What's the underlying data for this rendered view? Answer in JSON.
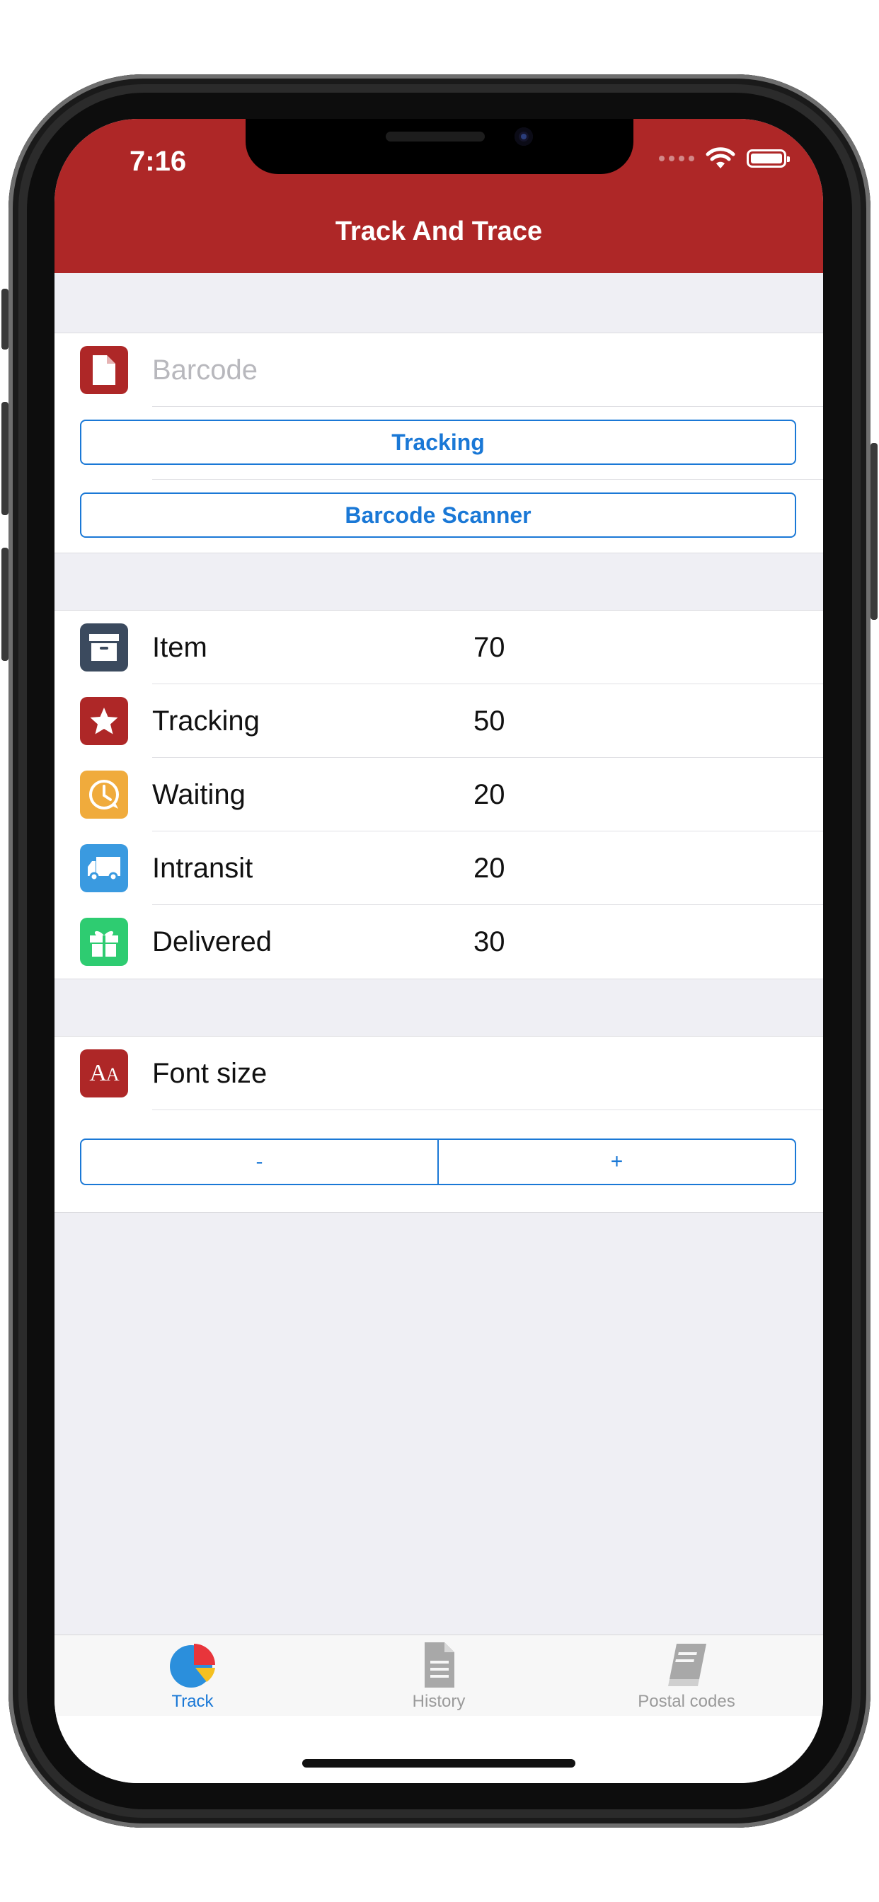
{
  "status_bar": {
    "time": "7:16"
  },
  "nav": {
    "title": "Track And Trace"
  },
  "search": {
    "placeholder": "Barcode",
    "tracking_button": "Tracking",
    "scanner_button": "Barcode Scanner"
  },
  "stats": [
    {
      "label": "Item",
      "value": "70",
      "icon": "archive-box-icon",
      "color": "#3b4a5e"
    },
    {
      "label": "Tracking",
      "value": "50",
      "icon": "star-icon",
      "color": "#ae2727"
    },
    {
      "label": "Waiting",
      "value": "20",
      "icon": "clock-icon",
      "color": "#f0ab3c"
    },
    {
      "label": "Intransit",
      "value": "20",
      "icon": "truck-icon",
      "color": "#3a9ae0"
    },
    {
      "label": "Delivered",
      "value": "30",
      "icon": "gift-icon",
      "color": "#2ecc71"
    }
  ],
  "font_size": {
    "label": "Font size",
    "icon": "font-size-icon",
    "decrease": "-",
    "increase": "+"
  },
  "tabbar": {
    "tabs": [
      {
        "label": "Track",
        "icon": "pie-chart-icon",
        "active": true
      },
      {
        "label": "History",
        "icon": "document-icon",
        "active": false
      },
      {
        "label": "Postal codes",
        "icon": "book-icon",
        "active": false
      }
    ]
  },
  "colors": {
    "header": "#ae2727",
    "accent": "#1a78d6",
    "background": "#efeff4"
  }
}
